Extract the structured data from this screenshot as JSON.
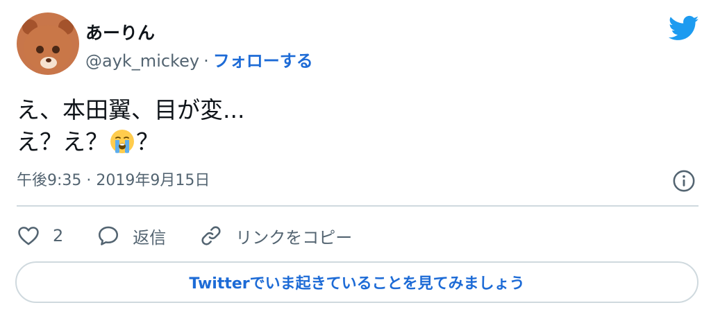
{
  "author": {
    "display_name": "あーりん",
    "handle": "@ayk_mickey",
    "separator": "·",
    "follow_label": "フォローする"
  },
  "tweet": {
    "line1": "え、本田翼、目が変...",
    "line2_a": "え？え？",
    "line2_b": "？",
    "emoji": "crying-face"
  },
  "meta": {
    "timestamp": "午後9:35 · 2019年9月15日"
  },
  "actions": {
    "like_count": "2",
    "reply_label": "返信",
    "copy_link_label": "リンクをコピー"
  },
  "cta": {
    "label": "Twitterでいま起きていることを見てみましょう"
  },
  "colors": {
    "accent": "#1d6bd6",
    "twitter_blue": "#1d9bf0",
    "muted": "#536471",
    "border": "#cfd9de"
  }
}
